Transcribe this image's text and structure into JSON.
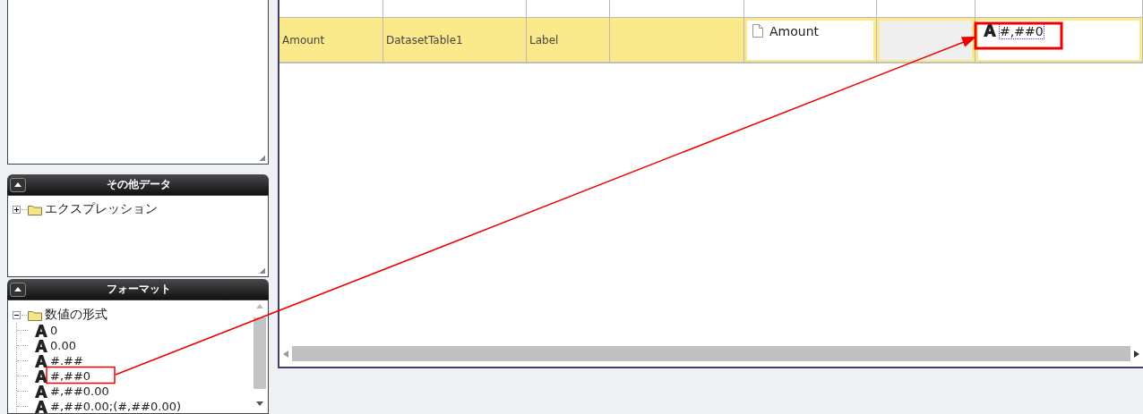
{
  "panels": [
    {
      "title": "その他データ",
      "tree": [
        {
          "label": "エクスプレッション",
          "kind": "folder",
          "expanded": false
        }
      ]
    },
    {
      "title": "フォーマット",
      "tree": [
        {
          "label": "数値の形式",
          "kind": "folder",
          "expanded": true,
          "children": [
            {
              "label": "0",
              "kind": "format"
            },
            {
              "label": "0.00",
              "kind": "format"
            },
            {
              "label": "#.##",
              "kind": "format"
            },
            {
              "label": "#,##0",
              "kind": "format"
            },
            {
              "label": "#,##0.00",
              "kind": "format"
            },
            {
              "label": "#,##0.00;(#,##0.00)",
              "kind": "format"
            }
          ]
        }
      ]
    }
  ],
  "grid": {
    "rows": [
      {
        "selected": true,
        "cells": [
          {
            "kind": "text",
            "text": "Amount"
          },
          {
            "kind": "text",
            "text": "DatasetTable1"
          },
          {
            "kind": "text",
            "text": "Label"
          },
          {
            "kind": "empty"
          },
          {
            "kind": "field",
            "text": "Amount"
          },
          {
            "kind": "inset"
          },
          {
            "kind": "format",
            "text": "#,##0",
            "focused": true
          }
        ]
      }
    ]
  }
}
